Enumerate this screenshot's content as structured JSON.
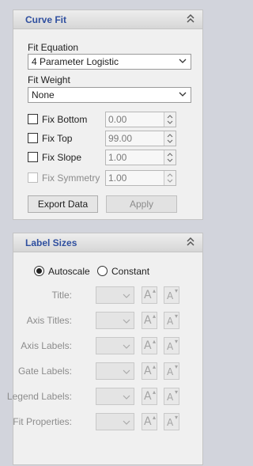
{
  "curve_fit": {
    "title": "Curve Fit",
    "fit_equation_label": "Fit Equation",
    "fit_equation_value": "4 Parameter Logistic",
    "fit_weight_label": "Fit Weight",
    "fit_weight_value": "None",
    "params": [
      {
        "label": "Fix Bottom",
        "value": "0.00",
        "enabled": true
      },
      {
        "label": "Fix Top",
        "value": "99.00",
        "enabled": true
      },
      {
        "label": "Fix Slope",
        "value": "1.00",
        "enabled": true
      },
      {
        "label": "Fix Symmetry",
        "value": "1.00",
        "enabled": false
      }
    ],
    "export_button": "Export Data",
    "apply_button": "Apply"
  },
  "label_sizes": {
    "title": "Label Sizes",
    "autoscale": "Autoscale",
    "constant": "Constant",
    "selected_mode": "Autoscale",
    "rows": [
      {
        "label": "Title:"
      },
      {
        "label": "Axis Titles:"
      },
      {
        "label": "Axis Labels:"
      },
      {
        "label": "Gate Labels:"
      },
      {
        "label": "Legend Labels:"
      },
      {
        "label": "Fit Properties:"
      }
    ],
    "increase_glyph": "A",
    "decrease_glyph": "A"
  },
  "colors": {
    "header_text": "#2f4f9f",
    "panel_bg": "#f0f0f0",
    "window_bg": "#d2d4dc"
  }
}
